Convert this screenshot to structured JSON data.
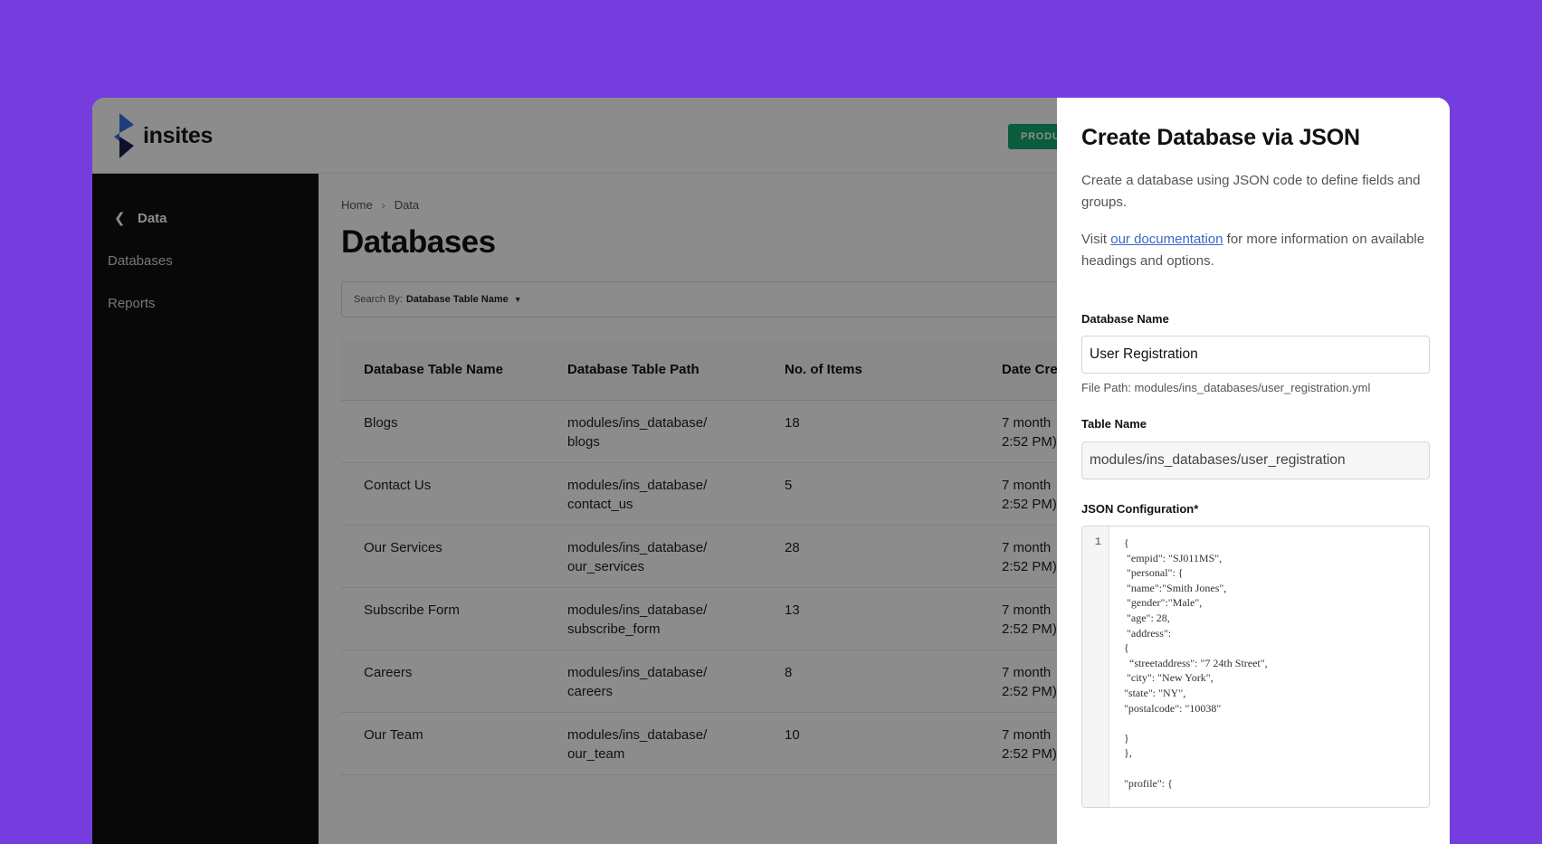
{
  "app": {
    "logo_text": "insites",
    "badge": "PRODU"
  },
  "sidebar": {
    "back_label": "Data",
    "items": [
      {
        "label": "Databases"
      },
      {
        "label": "Reports"
      }
    ]
  },
  "breadcrumb": {
    "home": "Home",
    "current": "Data"
  },
  "main": {
    "title": "Databases",
    "search": {
      "prefix": "Search By:",
      "value": "Database Table Name"
    }
  },
  "table": {
    "headers": [
      "Database Table Name",
      "Database Table Path",
      "No. of Items",
      "Date Cre"
    ],
    "rows": [
      {
        "name": "Blogs",
        "path1": "modules/ins_database/",
        "path2": "blogs",
        "items": "18",
        "date1": "7 month",
        "date2": "2:52 PM)"
      },
      {
        "name": "Contact Us",
        "path1": "modules/ins_database/",
        "path2": "contact_us",
        "items": "5",
        "date1": "7 month",
        "date2": "2:52 PM)"
      },
      {
        "name": "Our Services",
        "path1": "modules/ins_database/",
        "path2": "our_services",
        "items": "28",
        "date1": "7 month",
        "date2": "2:52 PM)"
      },
      {
        "name": "Subscribe Form",
        "path1": "modules/ins_database/",
        "path2": "subscribe_form",
        "items": "13",
        "date1": "7 month",
        "date2": "2:52 PM)"
      },
      {
        "name": "Careers",
        "path1": "modules/ins_database/",
        "path2": "careers",
        "items": "8",
        "date1": "7 month",
        "date2": "2:52 PM)"
      },
      {
        "name": "Our Team",
        "path1": "modules/ins_database/",
        "path2": "our_team",
        "items": "10",
        "date1": "7 month",
        "date2": "2:52 PM)"
      }
    ]
  },
  "drawer": {
    "title": "Create Database via JSON",
    "intro": "Create a database using JSON code to define fields and groups.",
    "visit_prefix": "Visit ",
    "doc_link": "our documentation",
    "visit_suffix": " for more information on available headings and options.",
    "db_name_label": "Database Name",
    "db_name_value": "User Registration",
    "file_path_hint": "File Path: modules/ins_databases/user_registration.yml",
    "table_name_label": "Table Name",
    "table_name_value": "modules/ins_databases/user_registration",
    "json_label": "JSON Configuration*",
    "line_number": "1",
    "code_lines": [
      "{",
      " \"empid\": \"SJ011MS\",",
      " \"personal\": {",
      " \"name\":\"Smith Jones\",",
      " \"gender\":\"Male\",",
      " \"age\": 28,",
      " \"address\":",
      "{",
      "  “streetaddress\": \"7 24th Street\",",
      " \"city\": \"New York\",",
      "\"state\": \"NY\",",
      "\"postalcode\": \"10038\"",
      "",
      "}",
      "},",
      "",
      "\"profile\": {"
    ]
  }
}
